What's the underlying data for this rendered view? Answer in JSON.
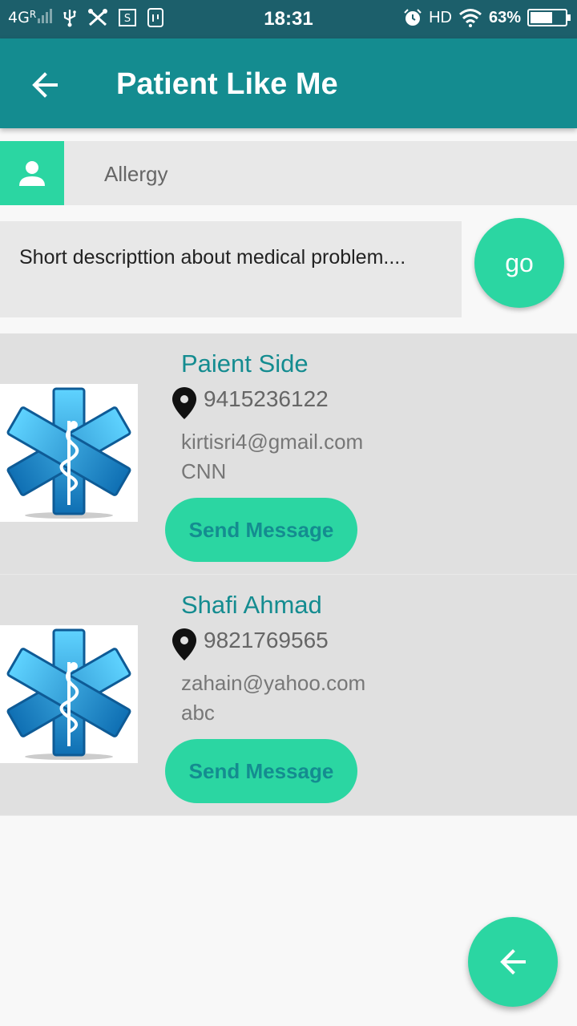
{
  "status_bar": {
    "network": "4G",
    "roaming": "R",
    "time": "18:31",
    "hd": "HD",
    "battery": "63%",
    "battery_level": 0.63,
    "icons": [
      "usb-icon",
      "tools-icon",
      "screenshot-icon",
      "usb-debug-icon",
      "alarm-icon",
      "wifi-icon",
      "battery-icon"
    ]
  },
  "app_bar": {
    "title": "Patient Like Me",
    "back_icon": "arrow-back-icon"
  },
  "search": {
    "icon": "person-icon",
    "value": "Allergy"
  },
  "description": {
    "text": "Short descripttion about medical problem...."
  },
  "go_button": {
    "label": "go"
  },
  "patients": [
    {
      "name": "Paient Side",
      "phone": "9415236122",
      "email": "kirtisri4@gmail.com",
      "org": "CNN",
      "button": "Send Message"
    },
    {
      "name": "Shafi Ahmad",
      "phone": "9821769565",
      "email": "zahain@yahoo.com",
      "org": "abc",
      "button": "Send Message"
    }
  ],
  "colors": {
    "status_bar": "#1c5f6b",
    "app_bar": "#148c90",
    "accent": "#2bd6a2"
  },
  "fab": {
    "icon": "arrow-back-icon"
  }
}
